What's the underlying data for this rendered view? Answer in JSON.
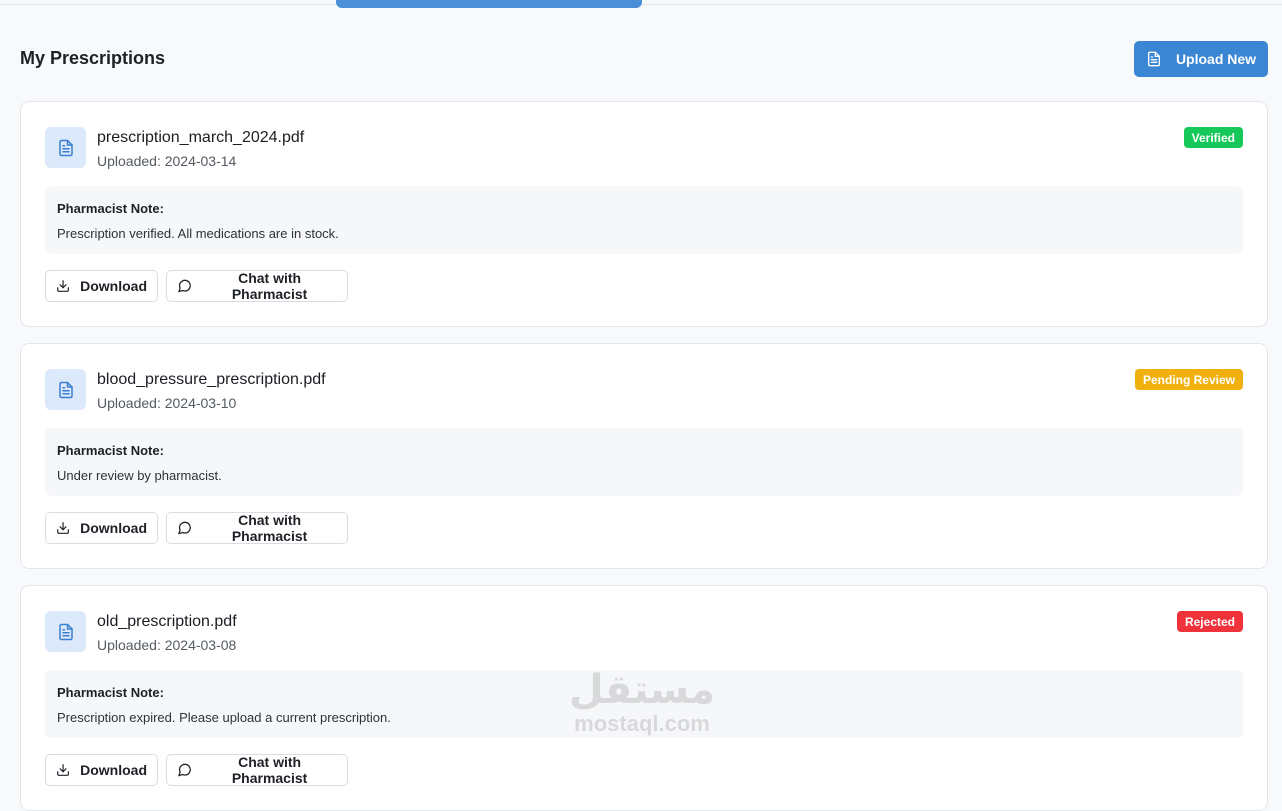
{
  "header": {
    "title": "My Prescriptions",
    "upload_label": "Upload New"
  },
  "prescriptions": [
    {
      "file_name": "prescription_march_2024.pdf",
      "uploaded": "Uploaded: 2024-03-14",
      "status": "Verified",
      "status_color": "#16c75a",
      "note_label": "Pharmacist Note:",
      "note_text": "Prescription verified. All medications are in stock.",
      "download_label": "Download",
      "chat_label": "Chat with Pharmacist"
    },
    {
      "file_name": "blood_pressure_prescription.pdf",
      "uploaded": "Uploaded: 2024-03-10",
      "status": "Pending Review",
      "status_color": "#f0b10e",
      "note_label": "Pharmacist Note:",
      "note_text": "Under review by pharmacist.",
      "download_label": "Download",
      "chat_label": "Chat with Pharmacist"
    },
    {
      "file_name": "old_prescription.pdf",
      "uploaded": "Uploaded: 2024-03-08",
      "status": "Rejected",
      "status_color": "#f0323a",
      "note_label": "Pharmacist Note:",
      "note_text": "Prescription expired. Please upload a current prescription.",
      "download_label": "Download",
      "chat_label": "Chat with Pharmacist"
    }
  ],
  "watermark": {
    "arabic": "مستقل",
    "latin": "mostaql.com"
  },
  "colors": {
    "accent": "#3a86d4",
    "icon_bg": "#dce9fa"
  }
}
